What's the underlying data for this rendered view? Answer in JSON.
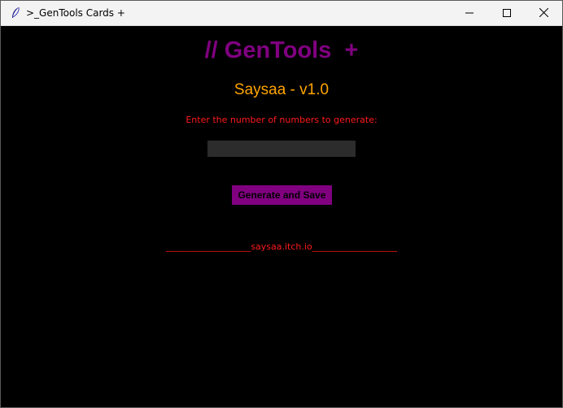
{
  "window": {
    "title": ">_GenTools Cards +"
  },
  "icons": {
    "app": "feather-icon",
    "minimize": "minimize-icon",
    "maximize": "maximize-icon",
    "close": "close-icon"
  },
  "main": {
    "heading": "// GenTools  +",
    "subtitle": "Saysaa - v1.0",
    "prompt": "Enter the number of numbers to generate:",
    "count_value": "",
    "generate_button_label": "Generate and Save",
    "footer_link": "___________________saysaa.itch.io___________________"
  },
  "colors": {
    "background": "#000000",
    "heading": "#800080",
    "subtitle": "#ffa500",
    "prompt": "#ff1a1a",
    "input_bg": "#2c2c2c",
    "button_bg": "#800080",
    "footer": "#ff1a1a"
  }
}
